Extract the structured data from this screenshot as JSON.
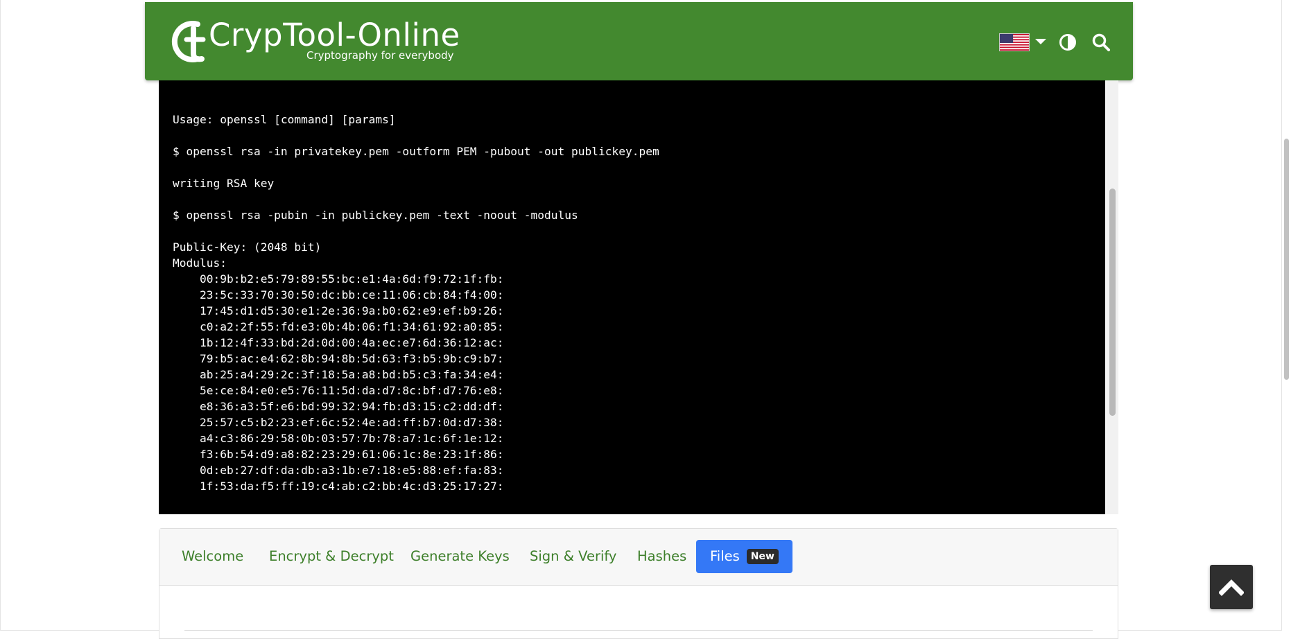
{
  "header": {
    "brand_title": "CrypTool-Online",
    "brand_subtitle": "Cryptography for everybody",
    "brand_color": "#43892f",
    "language_flag": "us-flag-icon",
    "contrast_icon": "contrast-icon",
    "search_icon": "search-icon"
  },
  "terminal": {
    "lines": [
      "Usage: openssl [command] [params]",
      "",
      "$ openssl rsa -in privatekey.pem -outform PEM -pubout -out publickey.pem",
      "",
      "writing RSA key",
      "",
      "$ openssl rsa -pubin -in publickey.pem -text -noout -modulus",
      "",
      "Public-Key: (2048 bit)",
      "Modulus:",
      "    00:9b:b2:e5:79:89:55:bc:e1:4a:6d:f9:72:1f:fb:",
      "    23:5c:33:70:30:50:dc:bb:ce:11:06:cb:84:f4:00:",
      "    17:45:d1:d5:30:e1:2e:36:9a:b0:62:e9:ef:b9:26:",
      "    c0:a2:2f:55:fd:e3:0b:4b:06:f1:34:61:92:a0:85:",
      "    1b:12:4f:33:bd:2d:0d:00:4a:ec:e7:6d:36:12:ac:",
      "    79:b5:ac:e4:62:8b:94:8b:5d:63:f3:b5:9b:c9:b7:",
      "    ab:25:a4:29:2c:3f:18:5a:a8:bd:b5:c3:fa:34:e4:",
      "    5e:ce:84:e0:e5:76:11:5d:da:d7:8c:bf:d7:76:e8:",
      "    e8:36:a3:5f:e6:bd:99:32:94:fb:d3:15:c2:dd:df:",
      "    25:57:c5:b2:23:ef:6c:52:4e:ad:ff:b7:0d:d7:38:",
      "    a4:c3:86:29:58:0b:03:57:7b:78:a7:1c:6f:1e:12:",
      "    f3:6b:54:d9:a8:82:23:29:61:06:1c:8e:23:1f:86:",
      "    0d:eb:27:df:da:db:a3:1b:e7:18:e5:88:ef:fa:83:",
      "    1f:53:da:f5:ff:19:c4:ab:c2:bb:4c:d3:25:17:27:"
    ]
  },
  "tabs": {
    "items": [
      {
        "label": "Welcome"
      },
      {
        "label": "Encrypt & Decrypt"
      },
      {
        "label": "Generate Keys"
      },
      {
        "label": "Sign & Verify"
      },
      {
        "label": "Hashes"
      },
      {
        "label": "Files",
        "badge": "New",
        "active": true
      }
    ],
    "active_color": "#3478f6",
    "link_color": "#3d7f2a"
  },
  "back_to_top": {
    "icon": "chevron-up-icon"
  }
}
